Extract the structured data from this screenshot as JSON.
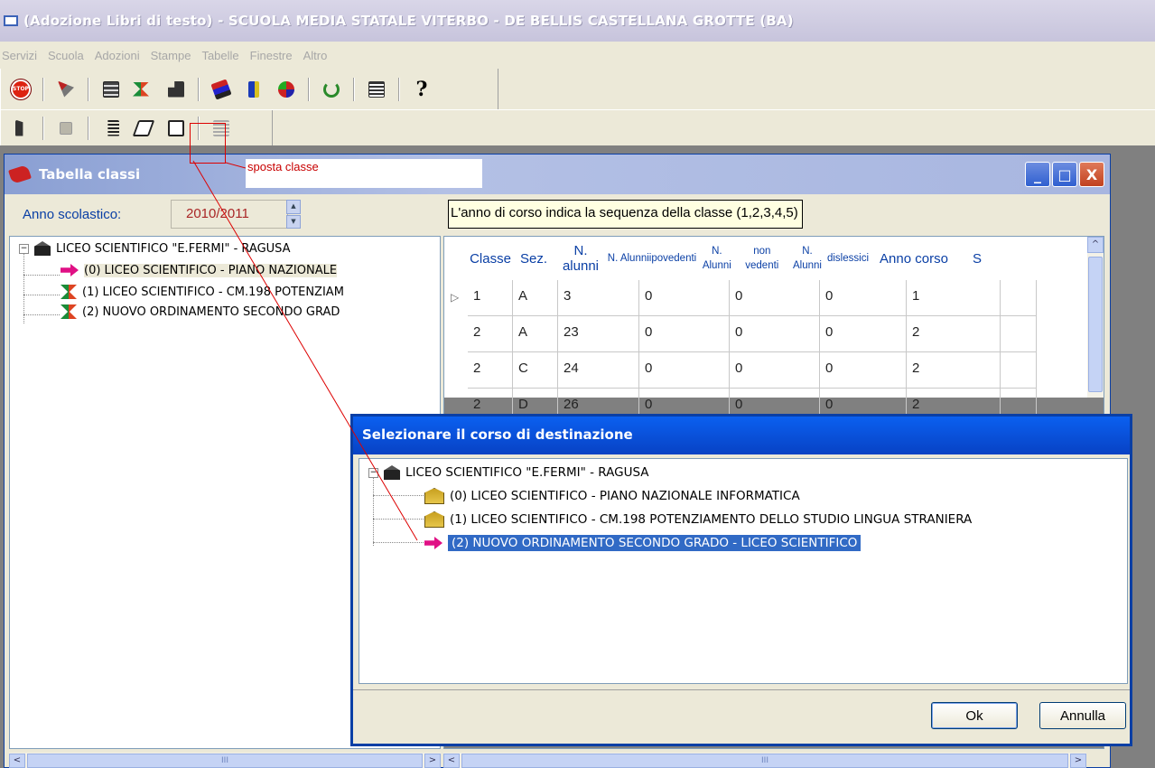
{
  "app": {
    "title": "(Adozione Libri di testo) - SCUOLA MEDIA STATALE VITERBO - DE BELLIS CASTELLANA GROTTE (BA)"
  },
  "menu": [
    "Servizi",
    "Scuola",
    "Adozioni",
    "Stampe",
    "Tabelle",
    "Finestre",
    "Altro"
  ],
  "toolbar1": {
    "icons": [
      "stop-icon",
      "scissors-icon",
      "catalog-icon",
      "hourglass-icon",
      "building-icon",
      "books-icon",
      "book-blue-icon",
      "transfer-icon",
      "refresh-icon",
      "report-icon",
      "help-icon"
    ],
    "help_glyph": "?"
  },
  "toolbar2": {
    "icons": [
      "exit-icon",
      "save-icon",
      "edit-icon",
      "eraser-icon",
      "move-class-icon",
      "disabled-list-icon"
    ]
  },
  "annotation": {
    "label": "sposta classe",
    "color": "#cc0000"
  },
  "window": {
    "title": "Tabella classi",
    "minimize": "_",
    "maximize": "□",
    "close": "X"
  },
  "anno_scolastico": {
    "label": "Anno scolastico:",
    "value": "2010/2011"
  },
  "tooltip": "L'anno di corso indica la sequenza della classe (1,2,3,4,5)",
  "tree": {
    "root": "LICEO SCIENTIFICO \"E.FERMI\"  - RAGUSA",
    "items": [
      {
        "label": "(0) LICEO SCIENTIFICO - PIANO NAZIONALE",
        "icon": "arrow-icon",
        "selected": true
      },
      {
        "label": "(1) LICEO SCIENTIFICO - CM.198 POTENZIAM",
        "icon": "hourglass-icon",
        "selected": false
      },
      {
        "label": "(2) NUOVO ORDINAMENTO SECONDO GRAD",
        "icon": "hourglass-icon",
        "selected": false
      }
    ]
  },
  "grid": {
    "headers": [
      {
        "lines": [
          "Classe"
        ],
        "size": "big"
      },
      {
        "lines": [
          "Sez."
        ],
        "size": "big"
      },
      {
        "lines": [
          "N. alunni"
        ],
        "size": "big"
      },
      {
        "lines": [
          "N. Alunni",
          "ipovedenti"
        ],
        "size": "small"
      },
      {
        "lines": [
          "N. Alunni",
          "non vedenti"
        ],
        "size": "small"
      },
      {
        "lines": [
          "N. Alunni",
          "dislessici"
        ],
        "size": "small"
      },
      {
        "lines": [
          "Anno corso"
        ],
        "size": "big"
      },
      {
        "lines": [
          "S"
        ],
        "size": "big"
      }
    ],
    "rows": [
      [
        "1",
        "A",
        "3",
        "0",
        "0",
        "0",
        "1",
        ""
      ],
      [
        "2",
        "A",
        "23",
        "0",
        "0",
        "0",
        "2",
        ""
      ],
      [
        "2",
        "C",
        "24",
        "0",
        "0",
        "0",
        "2",
        ""
      ],
      [
        "2",
        "D",
        "26",
        "0",
        "0",
        "0",
        "2",
        ""
      ]
    ],
    "current_row_indicator": "▷"
  },
  "dialog": {
    "title": "Selezionare il corso di destinazione",
    "root": "LICEO SCIENTIFICO \"E.FERMI\"  - RAGUSA",
    "items": [
      {
        "label": "(0) LICEO SCIENTIFICO - PIANO NAZIONALE INFORMATICA",
        "icon": "school-icon",
        "selected": false
      },
      {
        "label": "(1) LICEO SCIENTIFICO - CM.198 POTENZIAMENTO DELLO STUDIO LINGUA STRANIERA",
        "icon": "school-icon",
        "selected": false
      },
      {
        "label": "(2) NUOVO ORDINAMENTO SECONDO GRADO - LICEO SCIENTIFICO",
        "icon": "arrow-icon",
        "selected": true
      }
    ],
    "ok_label": "Ok",
    "cancel_label": "Annulla"
  },
  "scrollbars": {
    "left_arrow": "<",
    "right_arrow": ">",
    "grip": "III",
    "up_arrow": "^",
    "grip_v": "≡"
  }
}
